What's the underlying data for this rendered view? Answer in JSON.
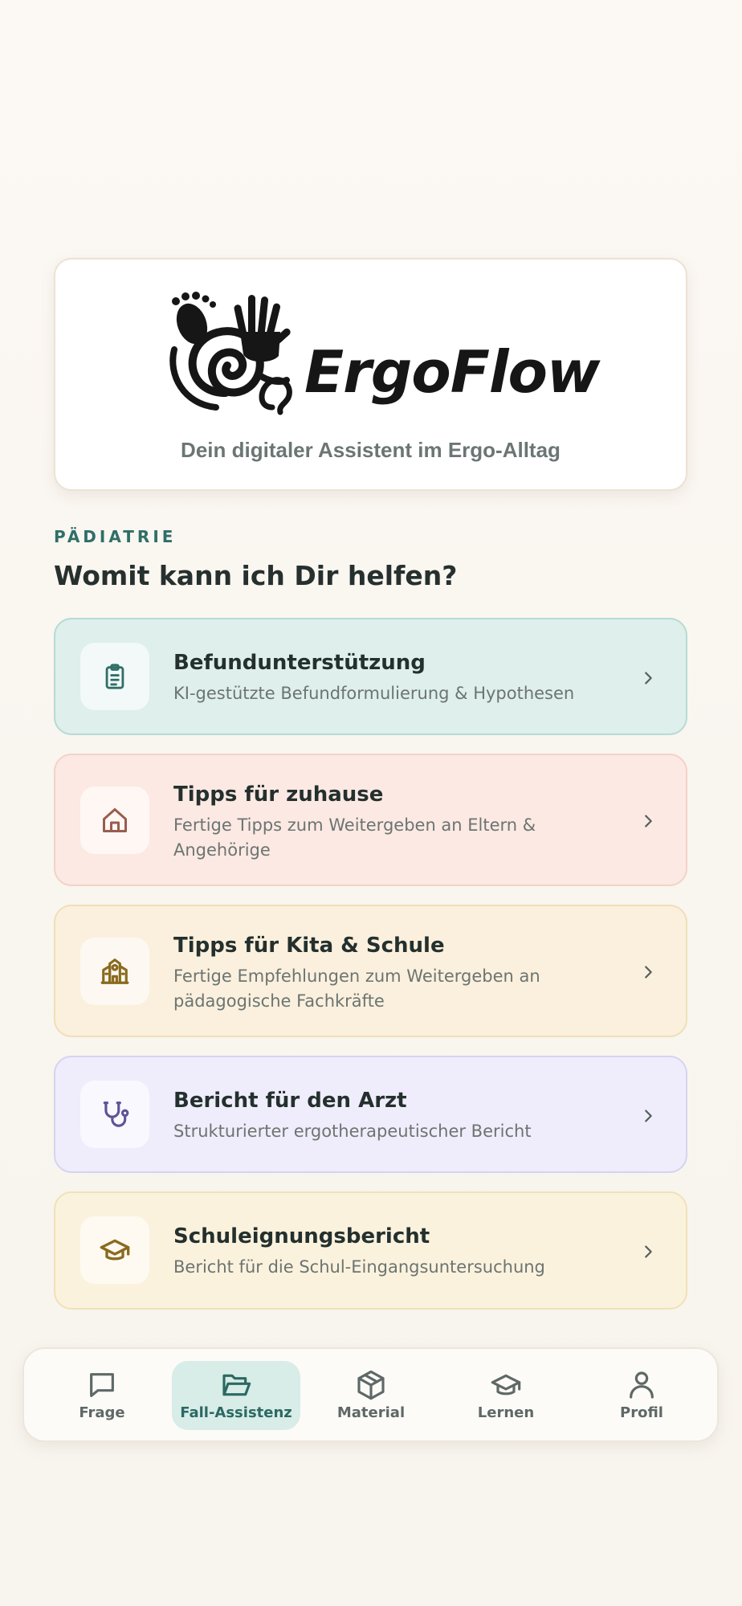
{
  "logo": {
    "wordmark": "ErgoFlow",
    "tagline": "Dein digitaler Assistent im Ergo-Alltag"
  },
  "section": {
    "kicker": "PÄDIATRIE",
    "title": "Womit kann ich Dir helfen?"
  },
  "cards": [
    {
      "title": "Befundunterstützung",
      "desc": "KI-gestützte Befundformulierung & Hypothesen",
      "icon": "clipboard-icon",
      "bg": "#deefec",
      "border": "#b6dbd4",
      "accent": "#2f6f68"
    },
    {
      "title": "Tipps für zuhause",
      "desc": "Fertige Tipps zum Weitergeben an Eltern & Angehörige",
      "icon": "home-icon",
      "bg": "#fce9e3",
      "border": "#f3d2c7",
      "accent": "#9a5c4e"
    },
    {
      "title": "Tipps für Kita & Schule",
      "desc": "Fertige Empfehlungen zum Weitergeben an pädagogische Fachkräfte",
      "icon": "school-icon",
      "bg": "#faf0dd",
      "border": "#f0dfb7",
      "accent": "#8a6a1e"
    },
    {
      "title": "Bericht für den Arzt",
      "desc": "Strukturierter ergotherapeutischer Bericht",
      "icon": "stethoscope-icon",
      "bg": "#efedfb",
      "border": "#d6d3f0",
      "accent": "#5e5496"
    },
    {
      "title": "Schuleignungsbericht",
      "desc": "Bericht für die Schul-Eingangsuntersuchung",
      "icon": "graduation-cap-icon",
      "bg": "#fbf2de",
      "border": "#f1e1b8",
      "accent": "#8a6a1e"
    }
  ],
  "nav": {
    "items": [
      {
        "label": "Frage",
        "icon": "chat-icon"
      },
      {
        "label": "Fall-Assistenz",
        "icon": "folder-open-icon",
        "active": true
      },
      {
        "label": "Material",
        "icon": "box-icon"
      },
      {
        "label": "Lernen",
        "icon": "graduation-cap-icon"
      },
      {
        "label": "Profil",
        "icon": "user-icon"
      }
    ]
  }
}
